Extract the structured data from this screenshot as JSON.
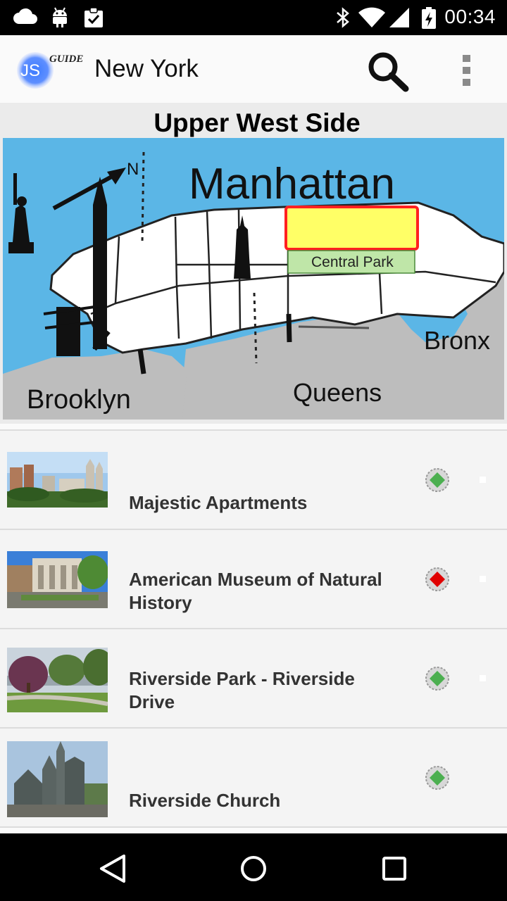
{
  "status_bar": {
    "time": "00:34",
    "icons": [
      "cloud-icon",
      "android-icon",
      "clipboard-check-icon",
      "bluetooth-icon",
      "wifi-icon",
      "cell-signal-icon",
      "battery-charging-icon"
    ]
  },
  "app_bar": {
    "logo_text": "JS",
    "logo_subtext": "GUIDE",
    "title": "New York",
    "actions": [
      "search-icon",
      "overflow-menu-icon"
    ]
  },
  "section": {
    "title": "Upper West Side",
    "map_labels": {
      "manhattan": "Manhattan",
      "north": "N",
      "central_park": "Central Park",
      "bronx": "Bronx",
      "brooklyn": "Brooklyn",
      "queens": "Queens"
    }
  },
  "places": [
    {
      "name": "Majestic Apartments",
      "marker_color": "#4caf50"
    },
    {
      "name": "American Museum of Natural History",
      "marker_color": "#e00000"
    },
    {
      "name": "Riverside Park - Riverside Drive",
      "marker_color": "#4caf50"
    },
    {
      "name": "Riverside Church",
      "marker_color": "#4caf50"
    }
  ],
  "nav_bar": {
    "buttons": [
      "back-icon",
      "home-icon",
      "recents-icon"
    ]
  }
}
